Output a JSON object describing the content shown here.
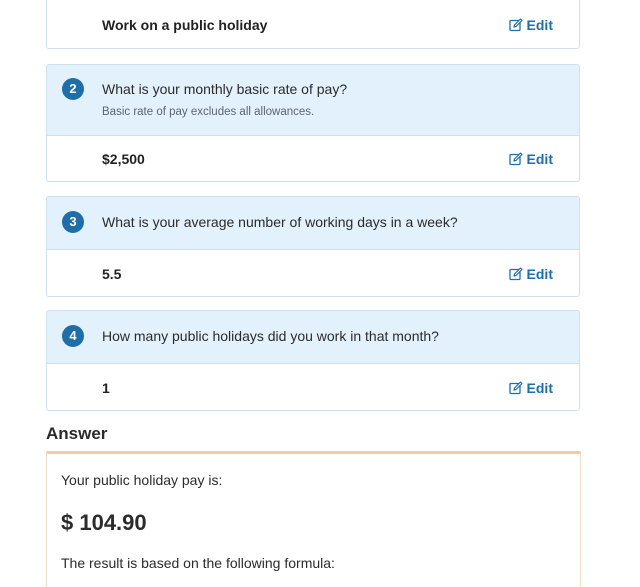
{
  "questions": [
    {
      "answer": "Work on a public holiday",
      "edit_label": "Edit"
    },
    {
      "number": "2",
      "question": "What is your monthly basic rate of pay?",
      "hint": "Basic rate of pay excludes all allowances.",
      "answer": "$2,500",
      "edit_label": "Edit"
    },
    {
      "number": "3",
      "question": "What is your average number of working days in a week?",
      "answer": "5.5",
      "edit_label": "Edit"
    },
    {
      "number": "4",
      "question": "How many public holidays did you work in that month?",
      "answer": "1",
      "edit_label": "Edit"
    }
  ],
  "answer": {
    "heading": "Answer",
    "label": "Your public holiday pay is:",
    "value": "$ 104.90",
    "formula_intro": "The result is based on the following formula:"
  },
  "colors": {
    "accent": "#1f6ea8",
    "question_bg": "#e3f1fc",
    "answer_border": "#f3c9a2"
  },
  "icons": {
    "edit": "pencil-square-icon"
  }
}
